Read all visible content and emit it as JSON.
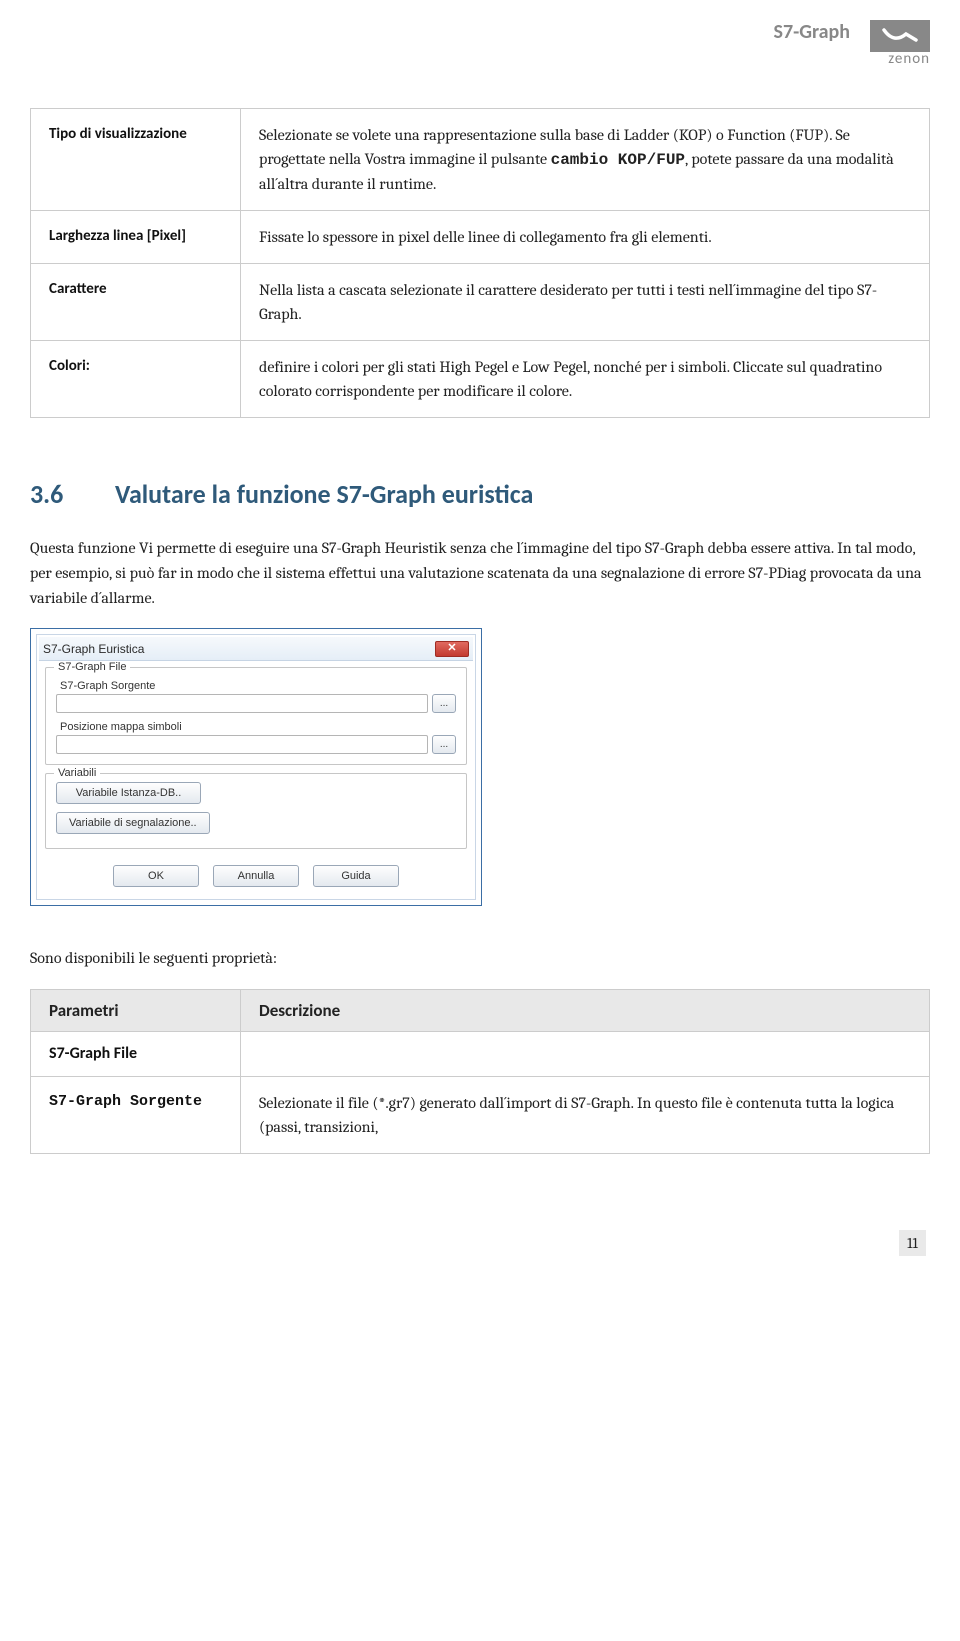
{
  "header": {
    "title": "S7-Graph",
    "logo_text": "zenon"
  },
  "table1": {
    "rows": [
      {
        "label": "Tipo di visualizzazione",
        "desc_before": "Selezionate se volete una rappresentazione sulla base di Ladder (KOP) o Function (FUP).\nSe progettate nella Vostra immagine il pulsante ",
        "mono": "cambio KOP/FUP",
        "desc_after": ", potete passare da una modalità all´altra durante il runtime."
      },
      {
        "label": "Larghezza linea [Pixel]",
        "desc": "Fissate lo spessore in pixel delle linee di collegamento fra gli elementi."
      },
      {
        "label": "Carattere",
        "desc": "Nella lista a cascata selezionate il carattere desiderato per tutti i testi nell´immagine del tipo S7-Graph."
      },
      {
        "label": "Colori:",
        "desc": "definire i colori per gli stati High Pegel e Low Pegel, nonché per i simboli. Cliccate sul quadratino colorato corrispondente per modificare il colore."
      }
    ]
  },
  "section": {
    "number": "3.6",
    "title": "Valutare la funzione S7-Graph euristica"
  },
  "paragraph": "Questa funzione Vi permette di eseguire una S7-Graph Heuristik senza che l´immagine del tipo S7-Graph debba essere attiva.  In tal modo, per esempio, si può far in modo che il sistema effettui una valutazione scatenata da una segnalazione di errore S7-PDiag provocata da una variabile d´allarme.",
  "dialog": {
    "title": "S7-Graph Euristica",
    "group_file": "S7-Graph File",
    "label_source": "S7-Graph Sorgente",
    "label_symbols": "Posizione mappa simboli",
    "browse": "...",
    "group_var": "Variabili",
    "btn_var_db": "Variabile Istanza-DB..",
    "btn_var_seg": "Variabile di segnalazione..",
    "btn_ok": "OK",
    "btn_cancel": "Annulla",
    "btn_help": "Guida",
    "close": "✕"
  },
  "props_intro": "Sono disponibili le seguenti proprietà:",
  "table2": {
    "head_param": "Parametri",
    "head_desc": "Descrizione",
    "subheader": "S7-Graph File",
    "row_label": "S7-Graph Sorgente",
    "row_desc": "Selezionate il file (*.gr7) generato dall´import di S7-Graph. In questo file è contenuta tutta la logica (passi, transizioni,"
  },
  "page_number": "11"
}
